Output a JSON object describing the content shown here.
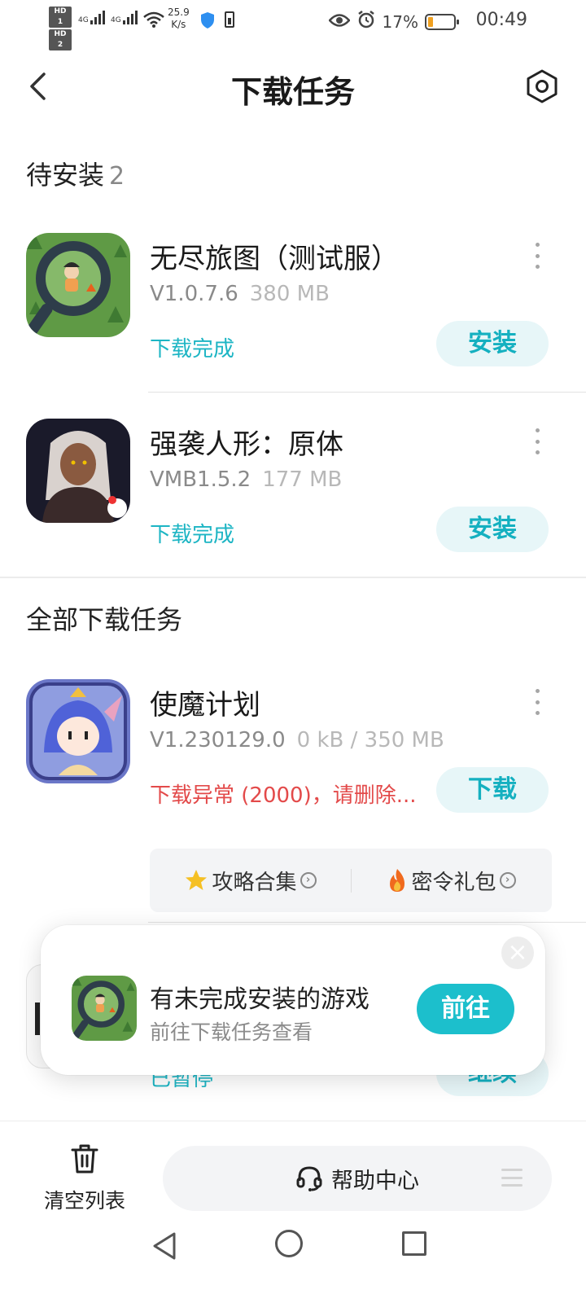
{
  "status_bar": {
    "hd1": "HD 1",
    "hd2": "HD 2",
    "net1": "4G",
    "net2": "4G",
    "speed_value": "25.9",
    "speed_unit": "K/s",
    "battery_percent": "17%",
    "time": "00:49"
  },
  "header": {
    "title": "下载任务"
  },
  "pending_section": {
    "title": "待安装",
    "count": "2",
    "items": [
      {
        "name": "无尽旅图（测试服）",
        "version": "V1.0.7.6",
        "size": "380 MB",
        "status": "下载完成",
        "action": "安装"
      },
      {
        "name": "强袭人形：原体",
        "version": "VMB1.5.2",
        "size": "177 MB",
        "status": "下载完成",
        "action": "安装"
      }
    ]
  },
  "all_section": {
    "title": "全部下载任务",
    "items": [
      {
        "name": "使魔计划",
        "version": "V1.230129.0",
        "size": "0 kB / 350 MB",
        "status": "下载异常 (2000)，请删除...",
        "action": "下载"
      }
    ],
    "extras": [
      {
        "label": "攻略合集",
        "icon": "star-icon"
      },
      {
        "label": "密令礼包",
        "icon": "fire-icon"
      }
    ],
    "hidden_item": {
      "status": "已暂停",
      "action": "继续"
    }
  },
  "popup": {
    "title": "有未完成安装的游戏",
    "subtitle": "前往下载任务查看",
    "button": "前往",
    "close": "×"
  },
  "bottom_bar": {
    "clear_label": "清空列表",
    "help_label": "帮助中心"
  },
  "colors": {
    "accent": "#1cbfcc",
    "accent_text": "#14b0c0",
    "accent_bg": "#e7f6f8",
    "error": "#e34a4a",
    "battery_low": "#f0a020"
  }
}
